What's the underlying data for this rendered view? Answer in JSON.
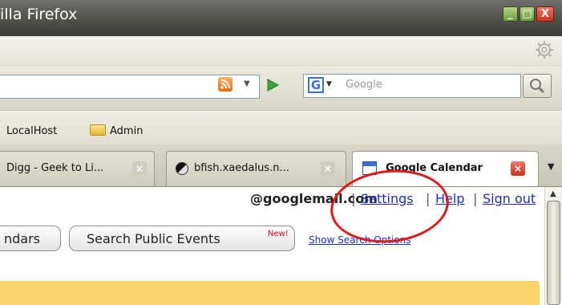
{
  "window": {
    "title": "illa Firefox",
    "controls": {
      "minimize": "_",
      "maximize": "□",
      "close": "X"
    }
  },
  "toolbar": {
    "search_placeholder": "Google",
    "icons": [
      "rss-icon",
      "dropdown-arrow-icon",
      "go-arrow-icon",
      "google-icon",
      "search-magnifier-icon",
      "gear-icon"
    ]
  },
  "bookmarks": {
    "items": [
      {
        "label": "LocalHost"
      },
      {
        "label": "Admin"
      }
    ]
  },
  "tabs": [
    {
      "label": "Digg - Geek to Li...",
      "active": false
    },
    {
      "label": "bfish.xaedalus.n...",
      "active": false
    },
    {
      "label": "Google Calendar",
      "active": true
    }
  ],
  "page": {
    "email": "@googlemail.com",
    "separator": "|",
    "links": {
      "settings": "Settings",
      "help": "Help",
      "sign_out": "Sign out"
    },
    "buttons": {
      "calendars": "ndars",
      "search_public_events": "Search Public Events"
    },
    "new_badge": "New!",
    "show_search_options": "Show Search Options"
  },
  "colors": {
    "annotation": "#e01818",
    "link": "#1f2fcc",
    "yellow_panel": "#fbd36b",
    "titlebar": "#56564f"
  }
}
